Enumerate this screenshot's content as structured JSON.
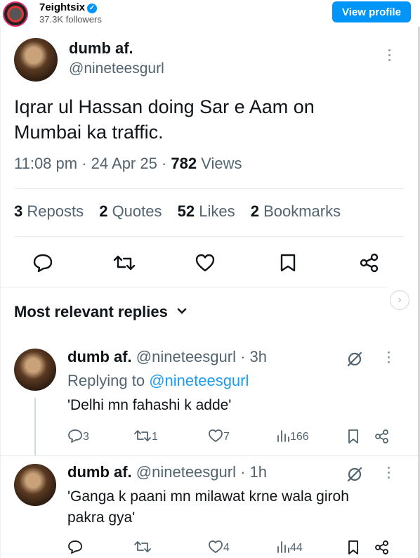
{
  "header": {
    "account_name": "7eightsix",
    "followers": "37.3K followers",
    "view_profile_label": "View profile"
  },
  "tweet": {
    "display_name": "dumb af.",
    "handle": "@nineteesgurl",
    "text": "Iqrar ul Hassan doing Sar e Aam on Mumbai ka traffic.",
    "meta_prefix": "11:08 pm · 24 Apr 25 · ",
    "views_count": "782",
    "views_label": " Views",
    "stats": [
      {
        "count": "3",
        "label": " Reposts"
      },
      {
        "count": "2",
        "label": " Quotes"
      },
      {
        "count": "52",
        "label": " Likes"
      },
      {
        "count": "2",
        "label": " Bookmarks"
      }
    ]
  },
  "replies_section": {
    "title": "Most relevant replies",
    "chevron": "chevron-down-icon"
  },
  "replies": [
    {
      "display_name": "dumb af.",
      "handle_time": " @nineteesgurl · 3h",
      "replying_prefix": "Replying to ",
      "replying_to": "@nineteesgurl",
      "text": "'Delhi mn fahashi k adde'",
      "reply_count": "3",
      "repost_count": "1",
      "like_count": "7",
      "views": "166"
    },
    {
      "display_name": "dumb af.",
      "handle_time": " @nineteesgurl · 1h",
      "text": "'Ganga k paani mn milawat krne wala giroh pakra gya'",
      "reply_count": "",
      "repost_count": "",
      "like_count": "4",
      "views": "44"
    }
  ],
  "colors": {
    "accent": "#1d9bf0",
    "instagram_button": "#0095f6",
    "secondary_text": "#536471",
    "primary_text": "#0f1419"
  }
}
